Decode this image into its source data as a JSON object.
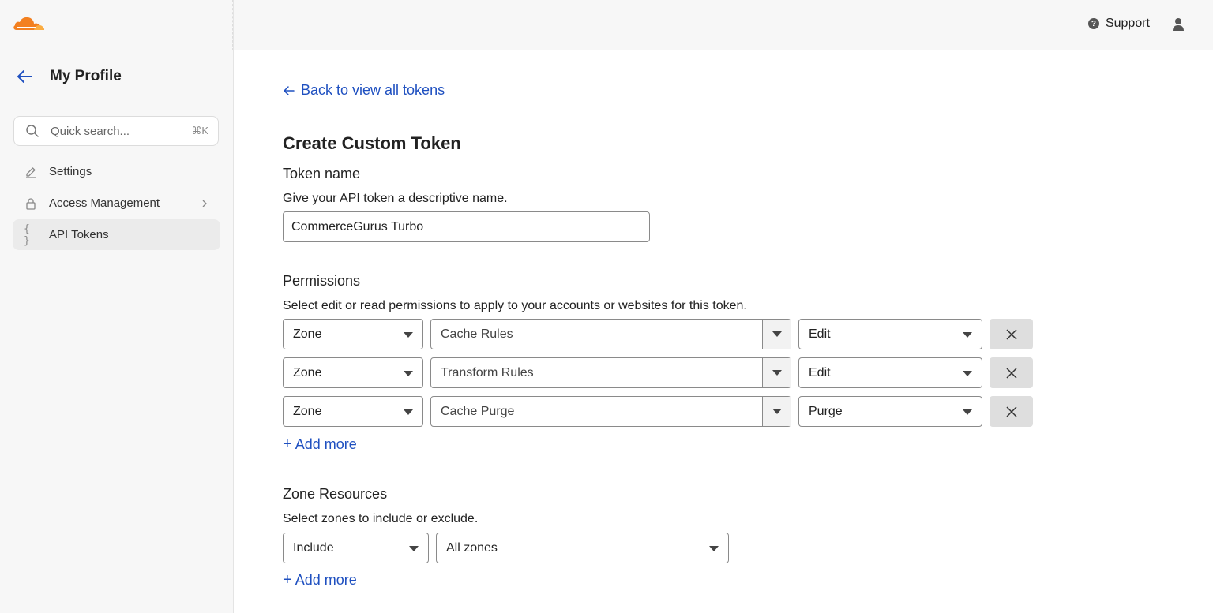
{
  "brand": {
    "accent": "#f38020",
    "link_color": "#1f50c0"
  },
  "sidebar": {
    "title": "My Profile",
    "search": {
      "placeholder": "Quick search...",
      "shortcut": "⌘K"
    },
    "items": [
      {
        "label": "Settings",
        "icon": "pencil-icon"
      },
      {
        "label": "Access Management",
        "icon": "lock-icon"
      },
      {
        "label": "API Tokens",
        "icon": "braces-icon",
        "active": true
      }
    ]
  },
  "header": {
    "support_label": "Support"
  },
  "main": {
    "back_link": "Back to view all tokens",
    "page_title": "Create Custom Token",
    "token_name": {
      "title": "Token name",
      "description": "Give your API token a descriptive name.",
      "value": "CommerceGurus Turbo"
    },
    "permissions": {
      "title": "Permissions",
      "description": "Select edit or read permissions to apply to your accounts or websites for this token.",
      "rows": [
        {
          "scope": "Zone",
          "resource": "Cache Rules",
          "access": "Edit"
        },
        {
          "scope": "Zone",
          "resource": "Transform Rules",
          "access": "Edit"
        },
        {
          "scope": "Zone",
          "resource": "Cache Purge",
          "access": "Purge"
        }
      ],
      "add_more": "Add more"
    },
    "zone_resources": {
      "title": "Zone Resources",
      "description": "Select zones to include or exclude.",
      "mode": "Include",
      "target": "All zones",
      "add_more": "Add more"
    }
  }
}
